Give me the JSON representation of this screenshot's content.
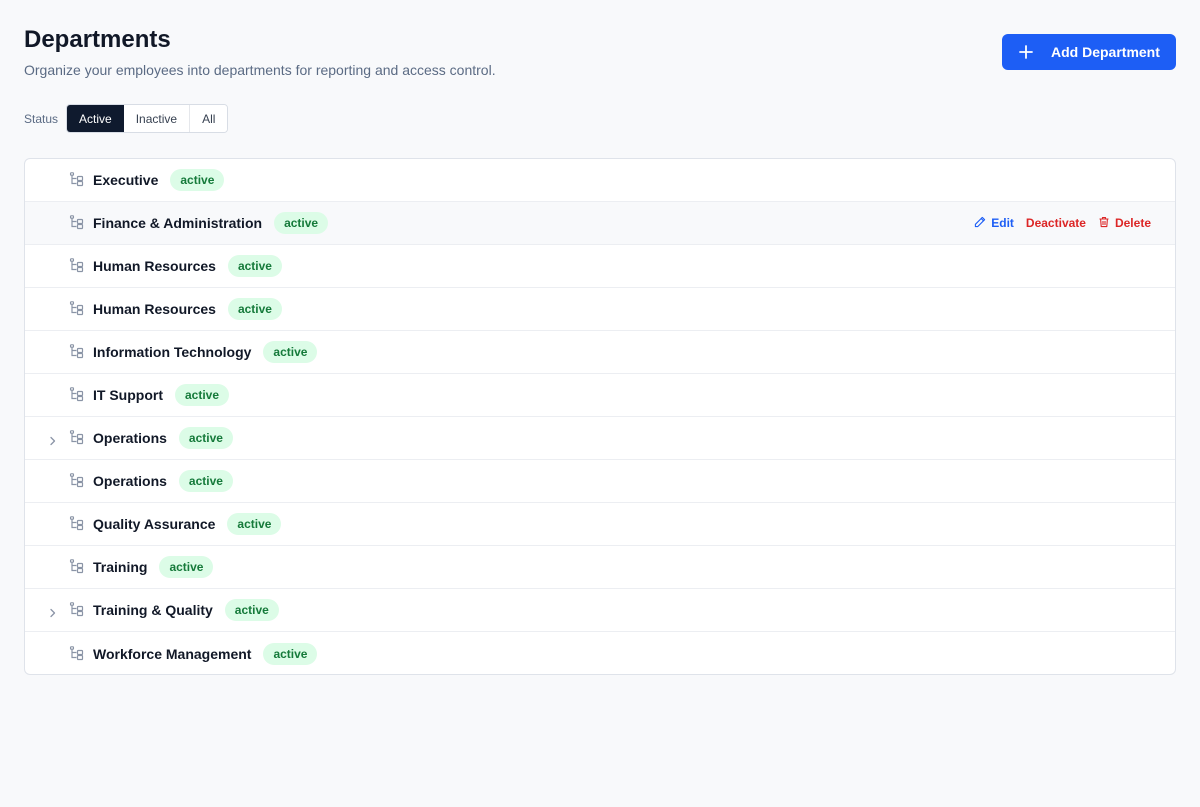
{
  "header": {
    "title": "Departments",
    "subtitle": "Organize your employees into departments for reporting and access control."
  },
  "toolbar": {
    "add_label": "Add Department"
  },
  "filter": {
    "label": "Status",
    "options": [
      "Active",
      "Inactive",
      "All"
    ],
    "selected": "Active"
  },
  "rows": [
    {
      "name": "Executive",
      "status": "active",
      "expandable": false
    },
    {
      "name": "Finance & Administration",
      "status": "active",
      "expandable": false
    },
    {
      "name": "Human Resources",
      "status": "active",
      "expandable": false
    },
    {
      "name": "Human Resources",
      "status": "active",
      "expandable": false
    },
    {
      "name": "Information Technology",
      "status": "active",
      "expandable": false
    },
    {
      "name": "IT Support",
      "status": "active",
      "expandable": false
    },
    {
      "name": "Operations",
      "status": "active",
      "expandable": true
    },
    {
      "name": "Operations",
      "status": "active",
      "expandable": false
    },
    {
      "name": "Quality Assurance",
      "status": "active",
      "expandable": false
    },
    {
      "name": "Training",
      "status": "active",
      "expandable": false
    },
    {
      "name": "Training & Quality",
      "status": "active",
      "expandable": true
    },
    {
      "name": "Workforce Management",
      "status": "active",
      "expandable": false
    }
  ],
  "row_actions": {
    "edit": "Edit",
    "deactivate": "Deactivate",
    "delete": "Delete",
    "shown_on_row": 1
  },
  "icons": {
    "add": "plus-icon",
    "row": "tree-structure-icon",
    "expand": "chevron-right-icon",
    "edit": "pencil-icon",
    "delete": "trash-icon"
  },
  "colors": {
    "primary": "#1d5ef5",
    "danger": "#dc2626",
    "badge_bg": "#dcfce7",
    "badge_text": "#157a3a",
    "segment_active": "#0f1a2e"
  }
}
